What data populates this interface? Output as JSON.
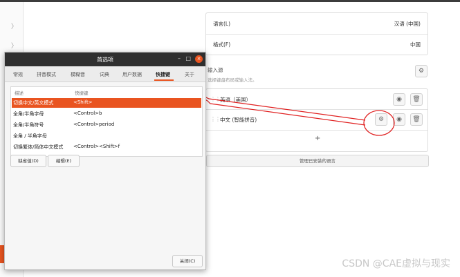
{
  "settings": {
    "rows": [
      {
        "label": "语言(L)",
        "value": "汉语 (中国)"
      },
      {
        "label": "格式(F)",
        "value": "中国"
      }
    ],
    "input_sources": {
      "title": "输入源",
      "subtitle": "选择键盘布局或输入法。",
      "items": [
        "英语（美国）",
        "中文 (智能拼音)"
      ],
      "add_label": "+",
      "manage_label": "管理已安装的语言"
    }
  },
  "dialog": {
    "title": "首选项",
    "minimize": "–",
    "maximize": "□",
    "close": "×",
    "tabs": [
      "常规",
      "拼音模式",
      "模糊音",
      "词典",
      "用户数据",
      "快捷键",
      "关于"
    ],
    "active_tab": "快捷键",
    "columns": {
      "desc": "描述",
      "key": "快捷键"
    },
    "shortcuts": [
      {
        "desc": "切换中文/英文模式",
        "key": "<Shift>"
      },
      {
        "desc": "全角/半角字母",
        "key": "<Control>b"
      },
      {
        "desc": "全角/半角符号",
        "key": "<Control>period"
      },
      {
        "desc": "全角 / 半角字母",
        "key": ""
      },
      {
        "desc": "切换繁体/简体中文模式",
        "key": "<Control><Shift>f"
      }
    ],
    "buttons": {
      "default": "缺省值(D)",
      "edit": "编辑(E)",
      "close": "关闭(C)"
    }
  },
  "watermark": "CSDN @CAE虚拟与现实",
  "colors": {
    "accent": "#e95420",
    "annotation": "#e02020",
    "titlebar": "#2f2f2f"
  }
}
